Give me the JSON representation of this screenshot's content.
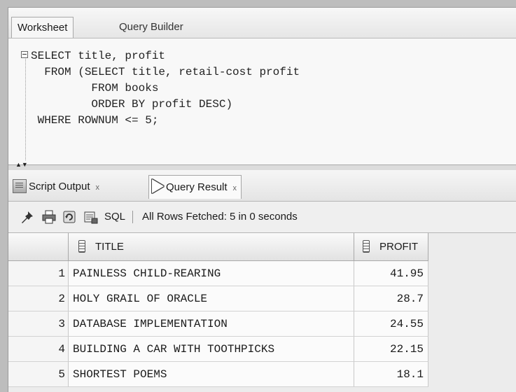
{
  "tabs": {
    "worksheet": "Worksheet",
    "query_builder": "Query Builder"
  },
  "editor": {
    "lines": [
      "SELECT title, profit",
      "  FROM (SELECT title, retail-cost profit",
      "         FROM books",
      "         ORDER BY profit DESC)",
      " WHERE ROWNUM <= 5;"
    ]
  },
  "result_tabs": {
    "script_output": "Script Output",
    "query_result": "Query Result",
    "close": "x"
  },
  "toolbar": {
    "sql_label": "SQL",
    "separator": "|",
    "status": "All Rows Fetched: 5 in 0 seconds"
  },
  "grid": {
    "columns": [
      "TITLE",
      "PROFIT"
    ],
    "rows": [
      {
        "n": "1",
        "title": "PAINLESS CHILD-REARING",
        "profit": "41.95"
      },
      {
        "n": "2",
        "title": "HOLY GRAIL OF ORACLE",
        "profit": "28.7"
      },
      {
        "n": "3",
        "title": "DATABASE IMPLEMENTATION",
        "profit": "24.55"
      },
      {
        "n": "4",
        "title": "BUILDING A CAR WITH TOOTHPICKS",
        "profit": "22.15"
      },
      {
        "n": "5",
        "title": "SHORTEST POEMS",
        "profit": "18.1"
      }
    ]
  }
}
